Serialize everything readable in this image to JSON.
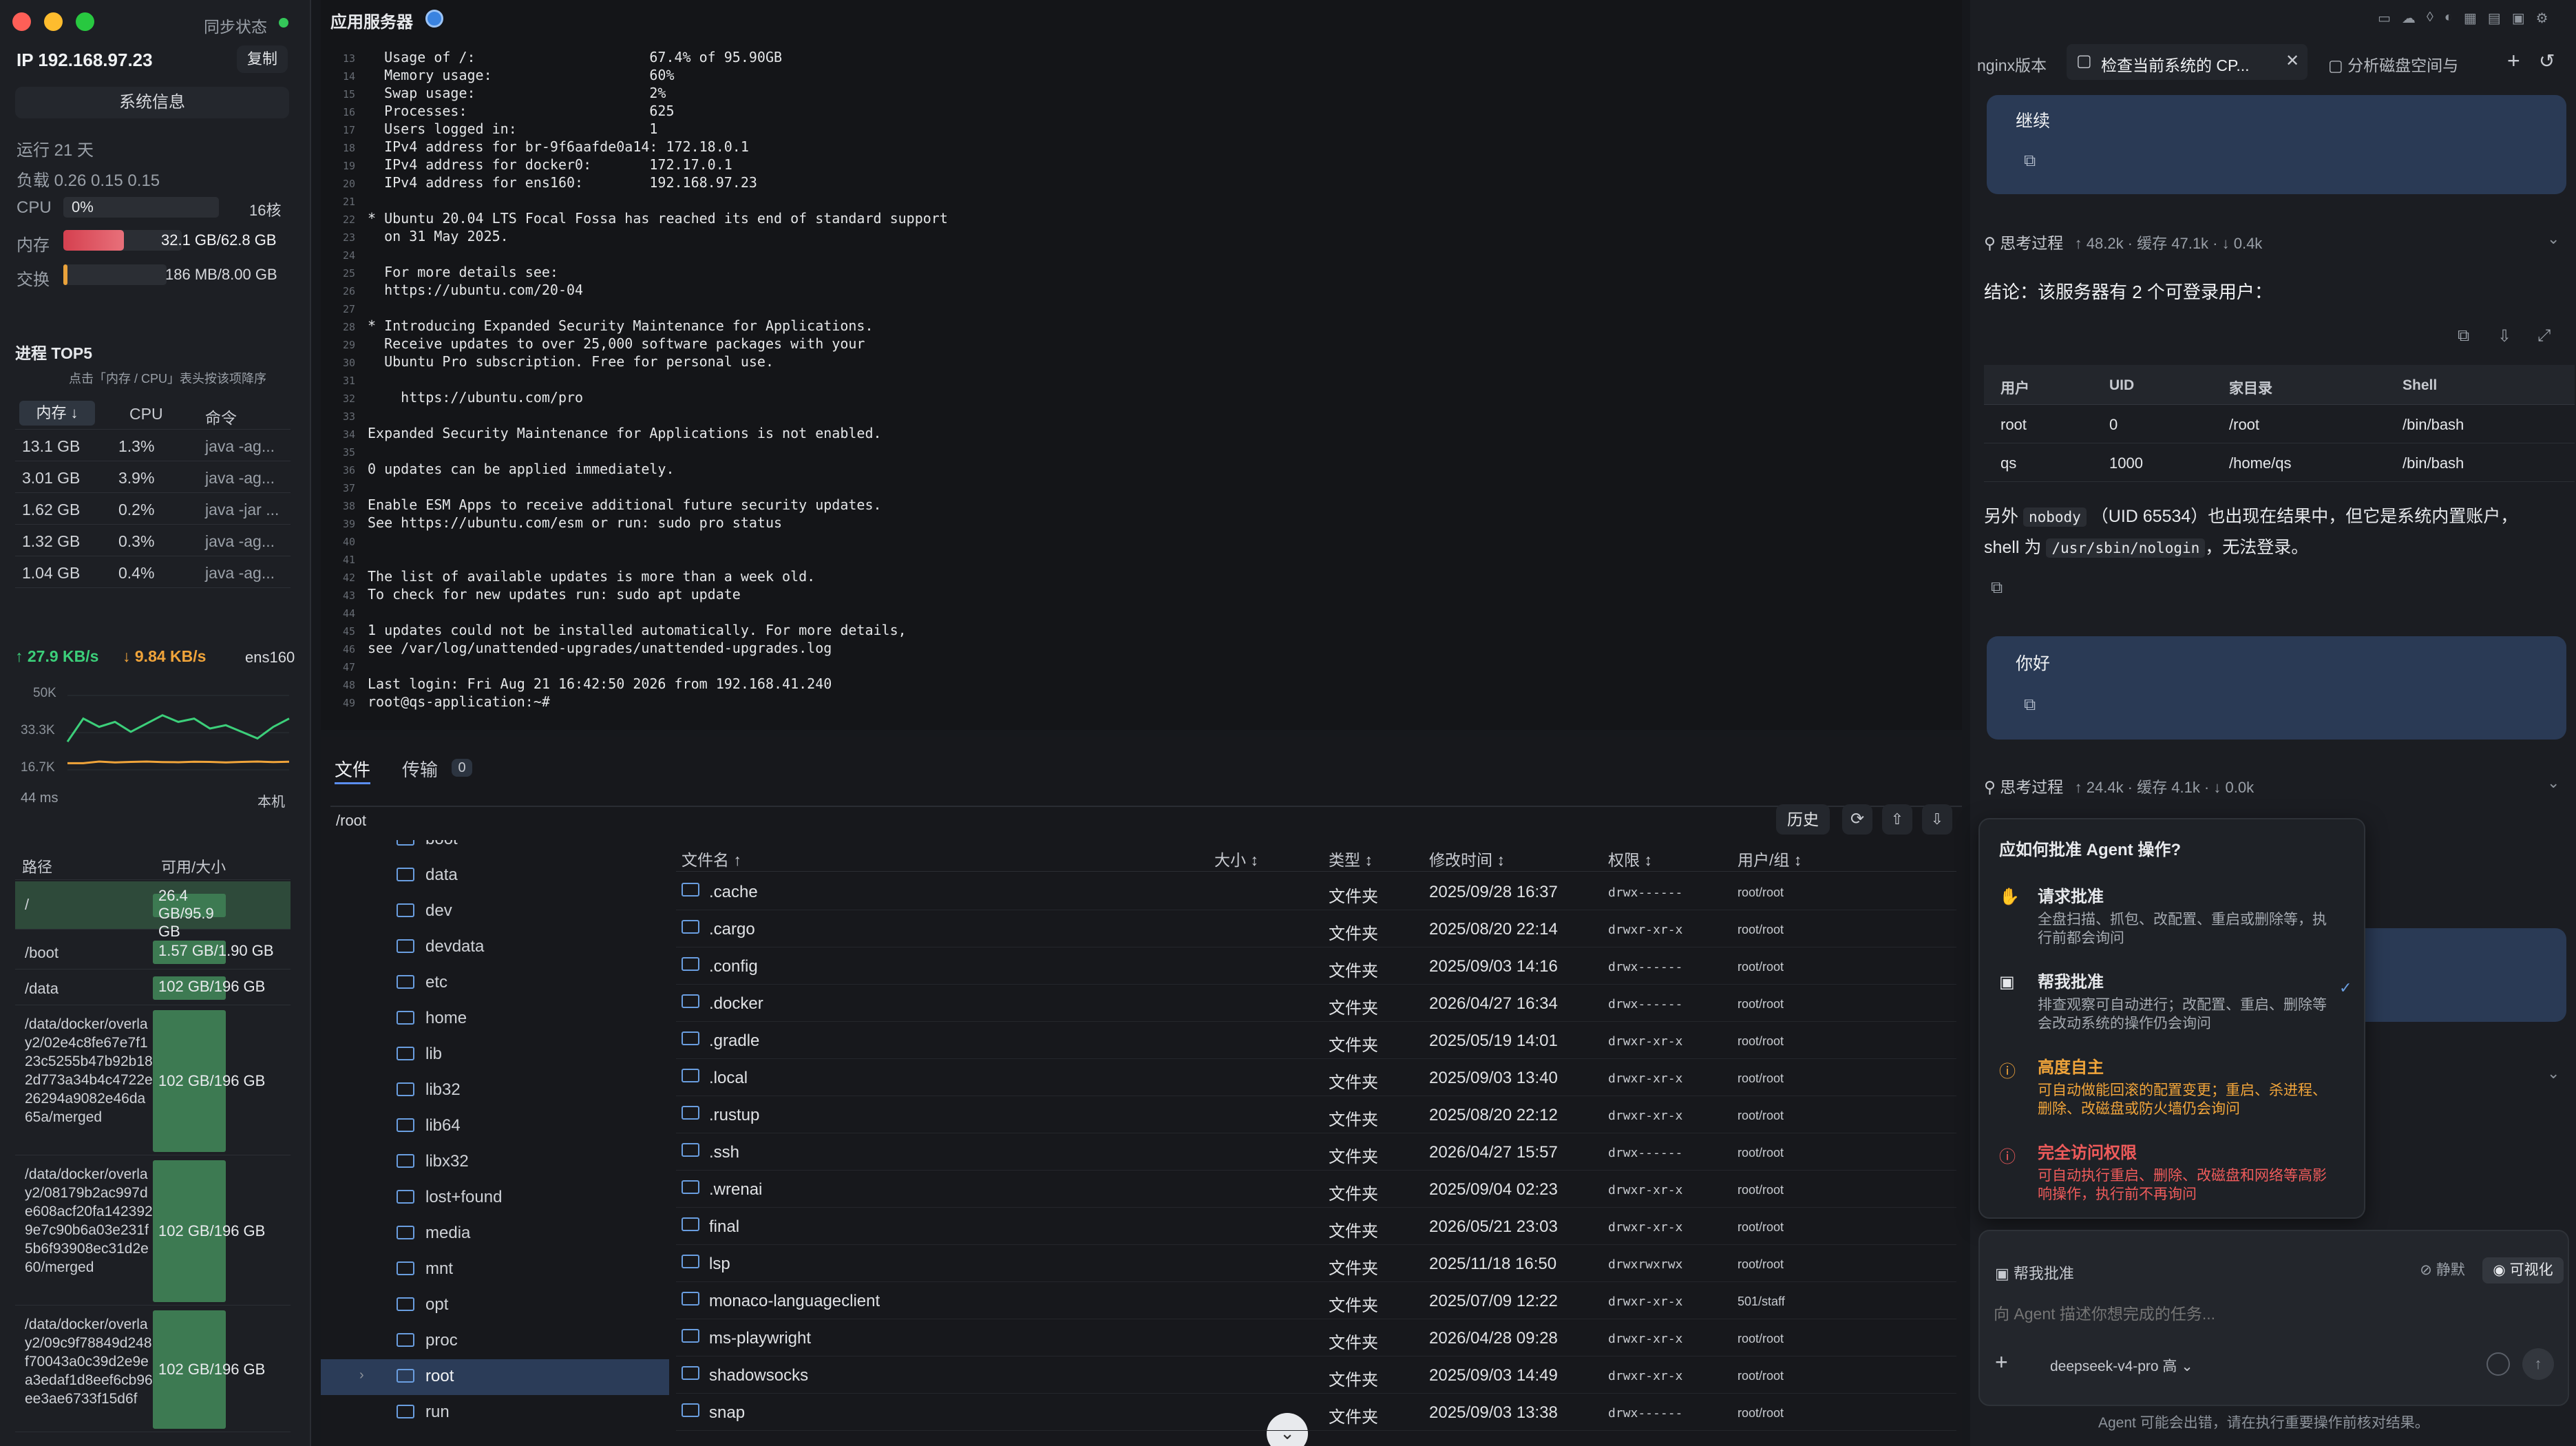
{
  "left": {
    "sync_status": "同步状态",
    "ip": "IP 192.168.97.23",
    "copy_button": "复制",
    "sysinfo_button": "系统信息",
    "uptime": "运行 21 天",
    "load": "负载 0.26 0.15 0.15",
    "cpu_label": "CPU",
    "cpu_value": "0%",
    "cpu_cores": "16核",
    "mem_label": "内存",
    "mem_value": "32.1 GB/62.8 GB",
    "mem_fraction": 0.51,
    "swap_label": "交换",
    "swap_value": "186 MB/8.00 GB",
    "swap_fraction": 0.023,
    "top5_title": "进程 TOP5",
    "top5_hint": "点击「内存 / CPU」表头按该项降序",
    "proc_headers": [
      "内存 ↓",
      "CPU",
      "命令"
    ],
    "procs": [
      {
        "mem": "13.1 GB",
        "cpu": "1.3%",
        "cmd": "java -ag..."
      },
      {
        "mem": "3.01 GB",
        "cpu": "3.9%",
        "cmd": "java -ag..."
      },
      {
        "mem": "1.62 GB",
        "cpu": "0.2%",
        "cmd": "java -jar ..."
      },
      {
        "mem": "1.32 GB",
        "cpu": "0.3%",
        "cmd": "java -ag..."
      },
      {
        "mem": "1.04 GB",
        "cpu": "0.4%",
        "cmd": "java -ag..."
      }
    ],
    "net_up": "↑ 27.9 KB/s",
    "net_down": "↓ 9.84 KB/s",
    "net_iface": "ens160",
    "net_y_ticks": [
      "50K",
      "33.3K",
      "16.7K"
    ],
    "net_latency": "44 ms",
    "net_host": "本机",
    "disk_headers": [
      "路径",
      "可用/大小"
    ],
    "disks": [
      {
        "path": "/",
        "value": "26.4 GB/95.9 GB",
        "fraction": 0.72
      },
      {
        "path": "/boot",
        "value": "1.57 GB/1.90 GB",
        "fraction": 0.17
      },
      {
        "path": "/data",
        "value": "102 GB/196 GB",
        "fraction": 0.48
      },
      {
        "path": "/data/docker/overlay2/02e4c8fe67e7f123c5255b47b92b182d773a34b4c4722e26294a9082e46da65a/merged",
        "value": "102 GB/196 GB",
        "fraction": 0.48
      },
      {
        "path": "/data/docker/overlay2/08179b2ac997de608acf20fa1423929e7c90b6a03e231f5b6f93908ec31d2e60/merged",
        "value": "102 GB/196 GB",
        "fraction": 0.48
      },
      {
        "path": "/data/docker/overlay2/09c9f78849d248f70043a0c39d2e9ea3edaf1d8eef6cb96ee3ae6733f15d6f",
        "value": "102 GB/196 GB",
        "fraction": 0.48
      }
    ]
  },
  "terminal": {
    "title": "应用服务器",
    "lines": [
      {
        "n": "13",
        "t": "  Usage of /:                     67.4% of 95.90GB"
      },
      {
        "n": "14",
        "t": "  Memory usage:                   60%"
      },
      {
        "n": "15",
        "t": "  Swap usage:                     2%"
      },
      {
        "n": "16",
        "t": "  Processes:                      625"
      },
      {
        "n": "17",
        "t": "  Users logged in:                1"
      },
      {
        "n": "18",
        "t": "  IPv4 address for br-9f6aafde0a14: 172.18.0.1"
      },
      {
        "n": "19",
        "t": "  IPv4 address for docker0:       172.17.0.1"
      },
      {
        "n": "20",
        "t": "  IPv4 address for ens160:        192.168.97.23"
      },
      {
        "n": "21",
        "t": ""
      },
      {
        "n": "22",
        "t": "* Ubuntu 20.04 LTS Focal Fossa has reached its end of standard support"
      },
      {
        "n": "23",
        "t": "  on 31 May 2025."
      },
      {
        "n": "24",
        "t": ""
      },
      {
        "n": "25",
        "t": "  For more details see:"
      },
      {
        "n": "26",
        "t": "  https://ubuntu.com/20-04"
      },
      {
        "n": "27",
        "t": ""
      },
      {
        "n": "28",
        "t": "* Introducing Expanded Security Maintenance for Applications."
      },
      {
        "n": "29",
        "t": "  Receive updates to over 25,000 software packages with your"
      },
      {
        "n": "30",
        "t": "  Ubuntu Pro subscription. Free for personal use."
      },
      {
        "n": "31",
        "t": ""
      },
      {
        "n": "32",
        "t": "    https://ubuntu.com/pro"
      },
      {
        "n": "33",
        "t": ""
      },
      {
        "n": "34",
        "t": "Expanded Security Maintenance for Applications is not enabled."
      },
      {
        "n": "35",
        "t": ""
      },
      {
        "n": "36",
        "t": "0 updates can be applied immediately."
      },
      {
        "n": "37",
        "t": ""
      },
      {
        "n": "38",
        "t": "Enable ESM Apps to receive additional future security updates."
      },
      {
        "n": "39",
        "t": "See https://ubuntu.com/esm or run: sudo pro status"
      },
      {
        "n": "40",
        "t": ""
      },
      {
        "n": "41",
        "t": ""
      },
      {
        "n": "42",
        "t": "The list of available updates is more than a week old."
      },
      {
        "n": "43",
        "t": "To check for new updates run: sudo apt update"
      },
      {
        "n": "44",
        "t": ""
      },
      {
        "n": "45",
        "t": "1 updates could not be installed automatically. For more details,"
      },
      {
        "n": "46",
        "t": "see /var/log/unattended-upgrades/unattended-upgrades.log"
      },
      {
        "n": "47",
        "t": ""
      },
      {
        "n": "48",
        "t": "Last login: Fri Aug 21 16:42:50 2026 from 192.168.41.240"
      },
      {
        "n": "49",
        "t": "root@qs-application:~#"
      }
    ]
  },
  "files": {
    "tab_files": "文件",
    "tab_transfer": "传输",
    "transfer_count": "0",
    "path": "/root",
    "history_button": "历史",
    "tree": [
      "boot",
      "data",
      "dev",
      "devdata",
      "etc",
      "home",
      "lib",
      "lib32",
      "lib64",
      "libx32",
      "lost+found",
      "media",
      "mnt",
      "opt",
      "proc",
      "root",
      "run"
    ],
    "tree_selected": "root",
    "headers": [
      "文件名 ↑",
      "大小 ↕",
      "类型 ↕",
      "修改时间 ↕",
      "权限 ↕",
      "用户/组 ↕"
    ],
    "rows": [
      {
        "name": ".cache",
        "type": "文件夹",
        "mtime": "2025/09/28 16:37",
        "perm": "drwx------",
        "owner": "root/root"
      },
      {
        "name": ".cargo",
        "type": "文件夹",
        "mtime": "2025/08/20 22:14",
        "perm": "drwxr-xr-x",
        "owner": "root/root"
      },
      {
        "name": ".config",
        "type": "文件夹",
        "mtime": "2025/09/03 14:16",
        "perm": "drwx------",
        "owner": "root/root"
      },
      {
        "name": ".docker",
        "type": "文件夹",
        "mtime": "2026/04/27 16:34",
        "perm": "drwx------",
        "owner": "root/root"
      },
      {
        "name": ".gradle",
        "type": "文件夹",
        "mtime": "2025/05/19 14:01",
        "perm": "drwxr-xr-x",
        "owner": "root/root"
      },
      {
        "name": ".local",
        "type": "文件夹",
        "mtime": "2025/09/03 13:40",
        "perm": "drwxr-xr-x",
        "owner": "root/root"
      },
      {
        "name": ".rustup",
        "type": "文件夹",
        "mtime": "2025/08/20 22:12",
        "perm": "drwxr-xr-x",
        "owner": "root/root"
      },
      {
        "name": ".ssh",
        "type": "文件夹",
        "mtime": "2026/04/27 15:57",
        "perm": "drwx------",
        "owner": "root/root"
      },
      {
        "name": ".wrenai",
        "type": "文件夹",
        "mtime": "2025/09/04 02:23",
        "perm": "drwxr-xr-x",
        "owner": "root/root"
      },
      {
        "name": "final",
        "type": "文件夹",
        "mtime": "2026/05/21 23:03",
        "perm": "drwxr-xr-x",
        "owner": "root/root"
      },
      {
        "name": "lsp",
        "type": "文件夹",
        "mtime": "2025/11/18 16:50",
        "perm": "drwxrwxrwx",
        "owner": "root/root"
      },
      {
        "name": "monaco-languageclient",
        "type": "文件夹",
        "mtime": "2025/07/09 12:22",
        "perm": "drwxr-xr-x",
        "owner": "501/staff"
      },
      {
        "name": "ms-playwright",
        "type": "文件夹",
        "mtime": "2026/04/28 09:28",
        "perm": "drwxr-xr-x",
        "owner": "root/root"
      },
      {
        "name": "shadowsocks",
        "type": "文件夹",
        "mtime": "2025/09/03 14:49",
        "perm": "drwxr-xr-x",
        "owner": "root/root"
      },
      {
        "name": "snap",
        "type": "文件夹",
        "mtime": "2025/09/03 13:38",
        "perm": "drwx------",
        "owner": "root/root"
      }
    ]
  },
  "chat": {
    "tabs": [
      "nginx版本",
      "检查当前系统的 CP...",
      "分析磁盘空间与"
    ],
    "msg1": "继续",
    "think1_label": "思考过程",
    "think1_stats": "↑ 48.2k · 缓存 47.1k · ↓ 0.4k",
    "conclusion": "结论：该服务器有 2 个可登录用户：",
    "user_table_headers": [
      "用户",
      "UID",
      "家目录",
      "Shell"
    ],
    "user_table_rows": [
      [
        "root",
        "0",
        "/root",
        "/bin/bash"
      ],
      [
        "qs",
        "1000",
        "/home/qs",
        "/bin/bash"
      ]
    ],
    "note_pre": "另外",
    "note_code1": "nobody",
    "note_mid": "（UID 65534）也出现在结果中，但它是系统内置账户，",
    "note_line2_pre": "shell 为",
    "note_code2": "/usr/sbin/nologin",
    "note_line2_post": "，无法登录。",
    "msg2": "你好",
    "think2_label": "思考过程",
    "think2_stats": "↑ 24.4k · 缓存 4.1k · ↓ 0.0k",
    "approve_title": "应如何批准 Agent 操作?",
    "options": [
      {
        "title": "请求批准",
        "desc": "全盘扫描、抓包、改配置、重启或删除等，执行前都会询问",
        "color": "#e6e8eb"
      },
      {
        "title": "帮我批准",
        "desc": "排查观察可自动进行；改配置、重启、删除等会改动系统的操作仍会询问",
        "color": "#e6e8eb"
      },
      {
        "title": "高度自主",
        "desc": "可自动做能回滚的配置变更；重启、杀进程、删除、改磁盘或防火墙仍会询问",
        "color": "#f0a43a"
      },
      {
        "title": "完全访问权限",
        "desc": "可自动执行重启、删除、改磁盘和网络等高影响操作，执行前不再询问",
        "color": "#ef5b5b"
      }
    ],
    "mode_label": "帮我批准",
    "mute_label": "静默",
    "visual_label": "可视化",
    "input_placeholder": "向 Agent 描述你想完成的任务...",
    "model": "deepseek-v4-pro 高",
    "disclaimer": "Agent 可能会出错，请在执行重要操作前核对结果。"
  },
  "net_chart": {
    "ylim": [
      0,
      50000
    ],
    "upload": [
      22000,
      36000,
      31000,
      34000,
      28000,
      33000,
      38000,
      34000,
      36000,
      30000,
      32000,
      28000,
      24000,
      31000,
      36000
    ],
    "download": [
      9000,
      9000,
      10000,
      9500,
      9800,
      10000,
      9700,
      9600,
      9900,
      9800,
      9500,
      9800,
      10000,
      9700,
      9900
    ]
  }
}
